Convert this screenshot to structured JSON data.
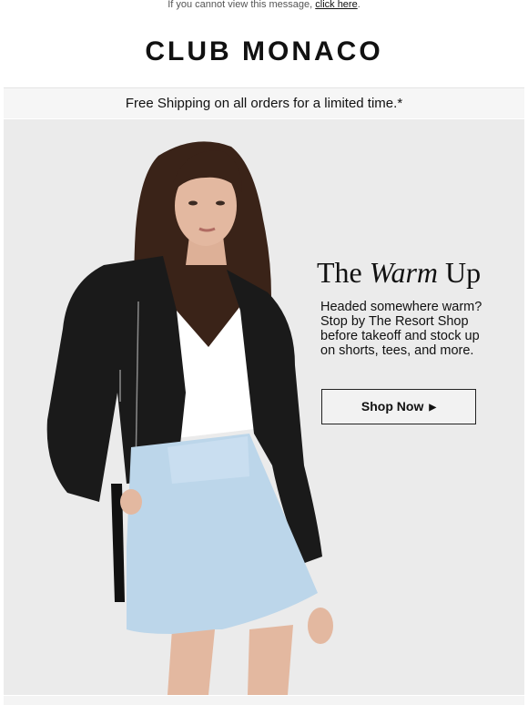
{
  "preheader": {
    "text": "If you cannot view this message, ",
    "link": "click here",
    "suffix": "."
  },
  "brand": {
    "logo": "CLUB MONACO"
  },
  "banner": {
    "text": "Free Shipping on all orders for a limited time.*"
  },
  "hero": {
    "headline_part1": "The ",
    "headline_italic": "Warm",
    "headline_part2": " Up",
    "body": "Headed somewhere warm? Stop by The Resort Shop before takeoff and stock up on shorts, tees, and more.",
    "cta_label": "Shop Now",
    "cta_icon": "caret-right-icon"
  },
  "colors": {
    "hero_bg": "#ebebeb",
    "jacket": "#1a1a1a",
    "shorts": "#bcd6ea",
    "hair": "#3a2318",
    "skin": "#e3b8a0"
  }
}
